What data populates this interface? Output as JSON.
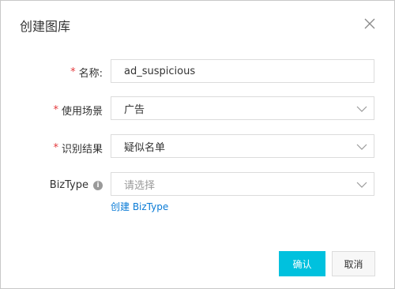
{
  "dialog": {
    "title": "创建图库",
    "close_icon": "close-icon"
  },
  "form": {
    "name": {
      "required_mark": "*",
      "label": "名称:",
      "value": "ad_suspicious"
    },
    "scene": {
      "required_mark": "*",
      "label": "使用场景",
      "value": "广告",
      "icon": "chevron-down-icon"
    },
    "result": {
      "required_mark": "*",
      "label": "识别结果",
      "value": "疑似名单",
      "icon": "chevron-down-icon"
    },
    "biztype": {
      "label": "BizType",
      "info_icon": "info-icon",
      "info_glyph": "i",
      "placeholder": "请选择",
      "icon": "chevron-down-icon"
    },
    "create_biztype_link": "创建 BizType"
  },
  "footer": {
    "confirm_label": "确认",
    "cancel_label": "取消"
  },
  "colors": {
    "accent": "#00c1de",
    "required": "#e4393c",
    "link": "#0a7bd6"
  }
}
